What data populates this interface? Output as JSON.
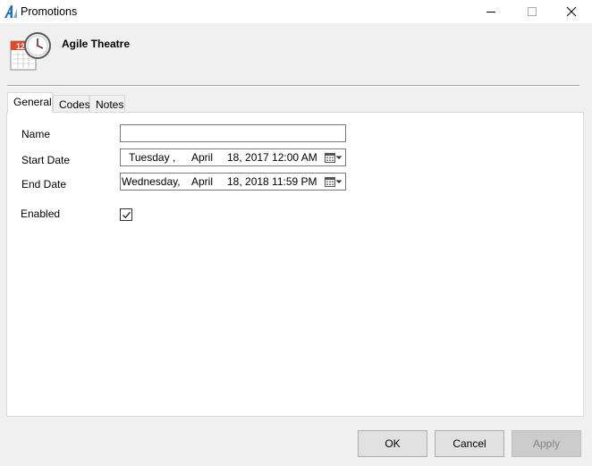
{
  "window": {
    "title": "Promotions",
    "accent": "#1e6fbf"
  },
  "header": {
    "title": "Agile Theatre",
    "icon": "calendar-clock-icon",
    "calendar_day": "12"
  },
  "tabs": [
    {
      "label": "General",
      "active": true
    },
    {
      "label": "Codes",
      "active": false
    },
    {
      "label": "Notes",
      "active": false
    }
  ],
  "form": {
    "name_label": "Name",
    "name_value": "",
    "start_label": "Start Date",
    "start": {
      "weekday": "Tuesday",
      "sep": ",",
      "month": "April",
      "rest": "18, 2017 12:00 AM"
    },
    "end_label": "End Date",
    "end": {
      "weekday": "Wednesday,",
      "month": "April",
      "rest": "18, 2018 11:59 PM"
    },
    "enabled_label": "Enabled",
    "enabled_checked": true
  },
  "buttons": {
    "ok": "OK",
    "cancel": "Cancel",
    "apply": "Apply"
  }
}
